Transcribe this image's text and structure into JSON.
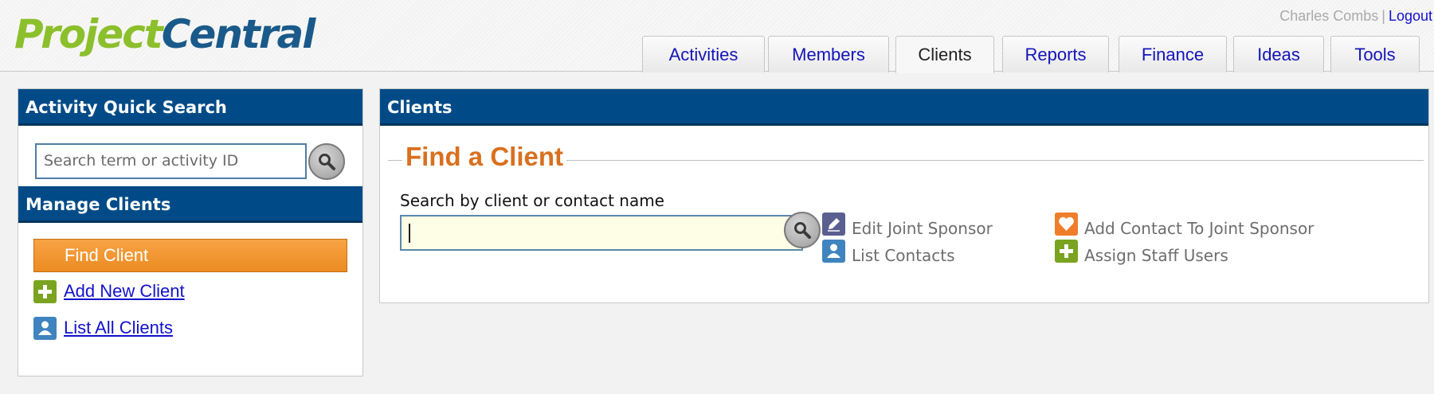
{
  "header": {
    "logo_part1": "Project",
    "logo_part2": "Central",
    "user_name": "Charles Combs",
    "separator": "|",
    "logout_label": "Logout"
  },
  "tabs": [
    {
      "label": "Activities",
      "active": false
    },
    {
      "label": "Members",
      "active": false
    },
    {
      "label": "Clients",
      "active": true
    },
    {
      "label": "Reports",
      "active": false
    },
    {
      "label": "Finance",
      "active": false
    },
    {
      "label": "Ideas",
      "active": false
    },
    {
      "label": "Tools",
      "active": false
    }
  ],
  "sidebar": {
    "quick_search_title": "Activity Quick Search",
    "quick_search_placeholder": "Search term or activity ID",
    "manage_title": "Manage Clients",
    "find_client_label": "Find Client",
    "add_new_client_label": "Add New Client",
    "list_all_clients_label": "List All Clients"
  },
  "main": {
    "panel_title": "Clients",
    "section_title": "Find a Client",
    "search_label": "Search by client or contact name",
    "search_value": "",
    "actions": {
      "edit_joint_sponsor": "Edit Joint Sponsor",
      "list_contacts": "List Contacts",
      "add_contact_joint_sponsor": "Add Contact To Joint Sponsor",
      "assign_staff_users": "Assign Staff Users"
    }
  },
  "colors": {
    "header_blue": "#004b87",
    "accent_orange": "#ec8c22",
    "title_orange": "#d9701e",
    "link_blue": "#1111cc",
    "icon_green": "#7aa320",
    "icon_blue": "#3f84be",
    "icon_orange": "#ef7d2c",
    "icon_purple": "#5a5f90"
  }
}
